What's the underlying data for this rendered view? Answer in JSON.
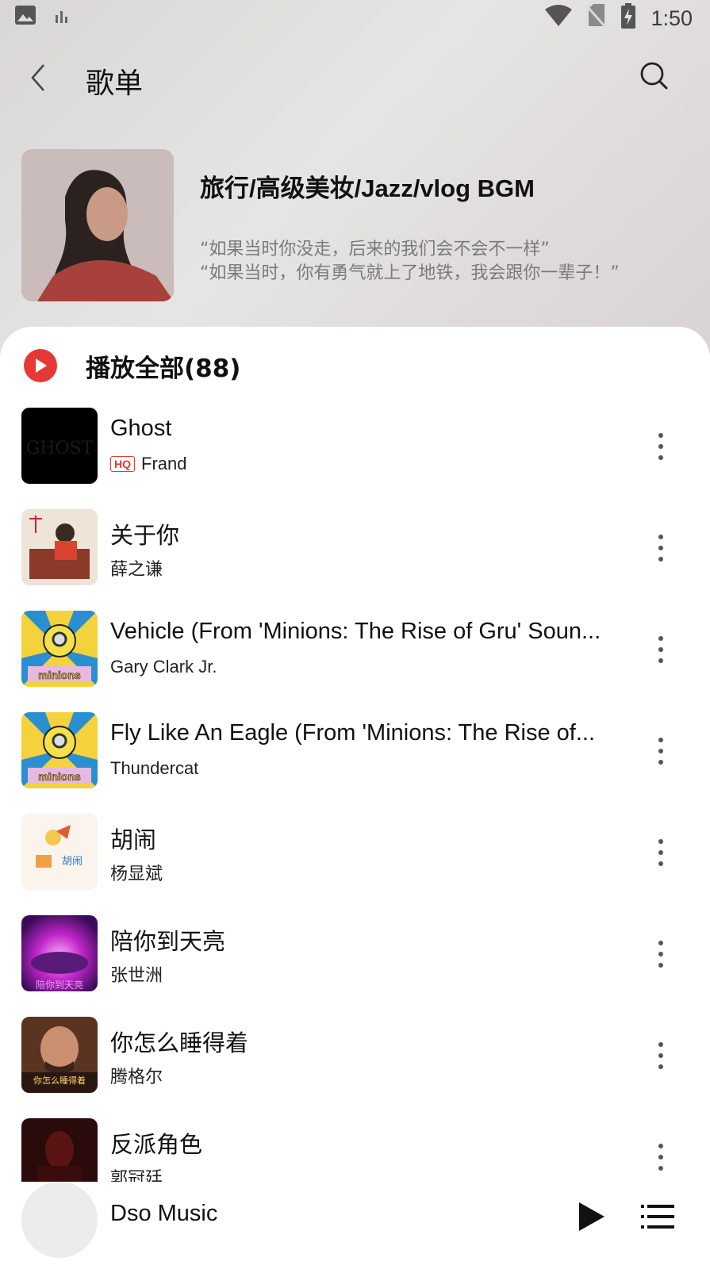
{
  "status": {
    "time": "1:50",
    "left_icons": [
      "image-icon",
      "bar-chart-icon"
    ],
    "right_icons": [
      "wifi-icon",
      "no-sim-icon",
      "battery-charging-icon"
    ]
  },
  "header": {
    "title": "歌单"
  },
  "playlist": {
    "title": "旅行/高级美妆/Jazz/vlog BGM",
    "desc_line1": "“如果当时你没走，后来的我们会不会不一样”",
    "desc_line2": "“如果当时，你有勇气就上了地铁，我会跟你一辈子！”"
  },
  "play_all": {
    "label": "播放全部(88)"
  },
  "songs": [
    {
      "title": "Ghost",
      "artist": "Frand",
      "hq": "HQ",
      "cover_text": "GHOST"
    },
    {
      "title": "关于你",
      "artist": "薛之谦"
    },
    {
      "title": "Vehicle (From 'Minions: The Rise of Gru' Soun...",
      "artist": "Gary Clark Jr.",
      "cover_text": "minions"
    },
    {
      "title": "Fly Like An Eagle (From 'Minions: The Rise of...",
      "artist": "Thundercat",
      "cover_text": "minions"
    },
    {
      "title": "胡闹",
      "artist": "杨显斌",
      "cover_text": "胡闹"
    },
    {
      "title": "陪你到天亮",
      "artist": "张世洲",
      "cover_text": "陪你到天亮"
    },
    {
      "title": "你怎么睡得着",
      "artist": "腾格尔",
      "cover_text": "你怎么睡得着"
    },
    {
      "title": "反派角色",
      "artist": "郭冠廷"
    }
  ],
  "player": {
    "title": "Dso Music"
  },
  "colors": {
    "accent": "#e53935",
    "header_bg": "#dedcdc"
  }
}
